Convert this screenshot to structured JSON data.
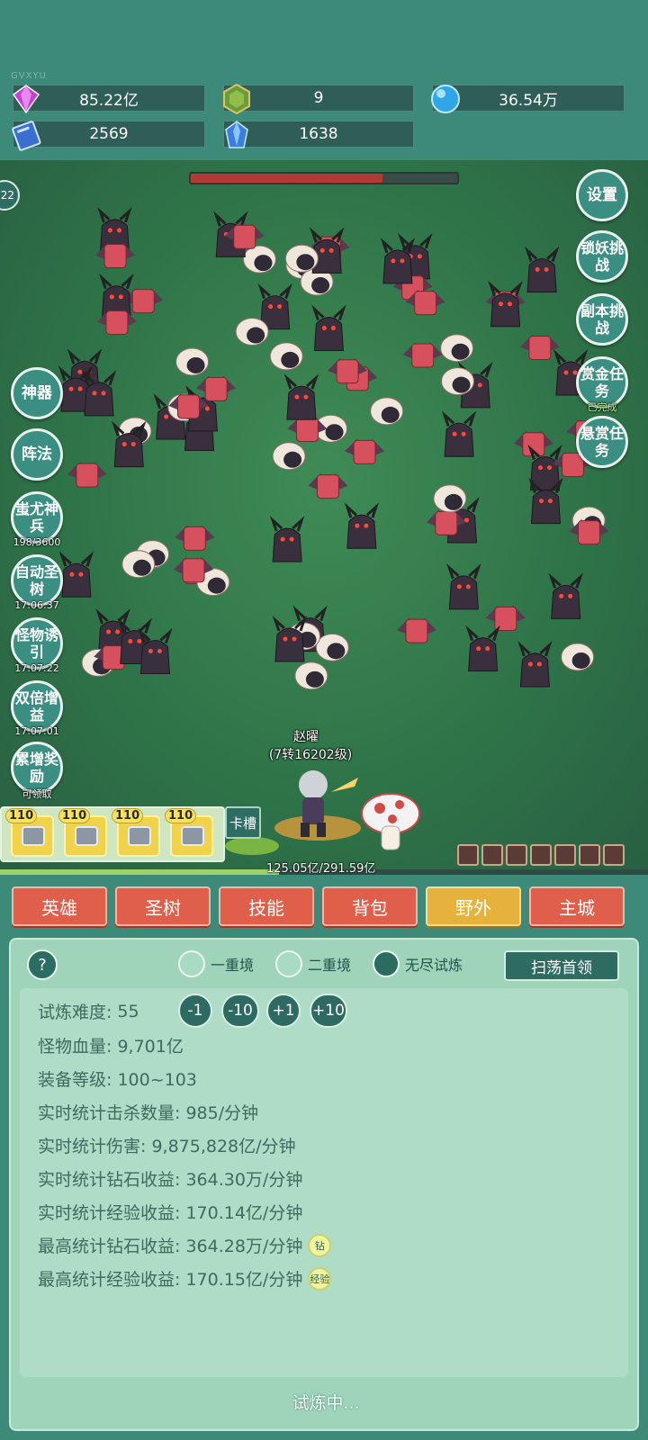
{
  "watermark": "GVXYU",
  "resources": {
    "diamond": {
      "value": "85.22亿",
      "icon": "purple-gem-icon"
    },
    "green_gem": {
      "value": "9",
      "icon": "green-gem-icon"
    },
    "orb": {
      "value": "36.54万",
      "icon": "blue-orb-icon"
    },
    "book": {
      "value": "2569",
      "icon": "blue-book-icon"
    },
    "crystal": {
      "value": "1638",
      "icon": "blue-crystal-icon"
    }
  },
  "boss_hp_fraction": 0.72,
  "left_buttons": [
    {
      "label": "神器",
      "sub": ""
    },
    {
      "label": "阵法",
      "sub": ""
    },
    {
      "label": "蚩尤神兵",
      "sub": "198/3600"
    },
    {
      "label": "自动圣树",
      "sub": "17:06:37"
    },
    {
      "label": "怪物诱引",
      "sub": "17:07:22"
    },
    {
      "label": "双倍增益",
      "sub": "17:07:01"
    },
    {
      "label": "累增奖励",
      "sub": "可领取"
    }
  ],
  "left_badge": "22",
  "right_buttons": [
    {
      "label": "设置",
      "sub": ""
    },
    {
      "label": "锁妖挑战",
      "sub": ""
    },
    {
      "label": "副本挑战",
      "sub": ""
    },
    {
      "label": "赏金任务",
      "sub": "已完成"
    },
    {
      "label": "悬赏任务",
      "sub": ""
    }
  ],
  "hero": {
    "name": "赵曜",
    "level": "(7转16202级)"
  },
  "exp": {
    "text": "125.05亿/291.59亿",
    "fraction": 0.43
  },
  "slots": [
    {
      "level": "110",
      "icon": "sword-icon"
    },
    {
      "level": "110",
      "icon": "helmet-icon"
    },
    {
      "level": "110",
      "icon": "armor-icon"
    },
    {
      "level": "110",
      "icon": "boots-icon"
    }
  ],
  "card_slot_label": "卡槽",
  "tabs": [
    "英雄",
    "圣树",
    "技能",
    "背包",
    "野外",
    "主城"
  ],
  "active_tab": "野外",
  "panel": {
    "help": "?",
    "modes": [
      {
        "label": "一重境",
        "selected": false
      },
      {
        "label": "二重境",
        "selected": false
      },
      {
        "label": "无尽试炼",
        "selected": true
      }
    ],
    "sweep_button": "扫荡首领",
    "difficulty_label": "试炼难度:",
    "difficulty_value": "55",
    "adjust_buttons": [
      "-1",
      "-10",
      "+1",
      "+10"
    ],
    "lines": [
      "怪物血量: 9,701亿",
      "装备等级: 100~103",
      "实时统计击杀数量: 985/分钟",
      "实时统计伤害: 9,875,828亿/分钟",
      "实时统计钻石收益: 364.30万/分钟",
      "实时统计经验收益: 170.14亿/分钟",
      "最高统计钻石收益: 364.28万/分钟",
      "最高统计经验收益: 170.15亿/分钟"
    ],
    "badge_diamond": "钻",
    "badge_exp": "经验",
    "status": "试炼中..."
  }
}
